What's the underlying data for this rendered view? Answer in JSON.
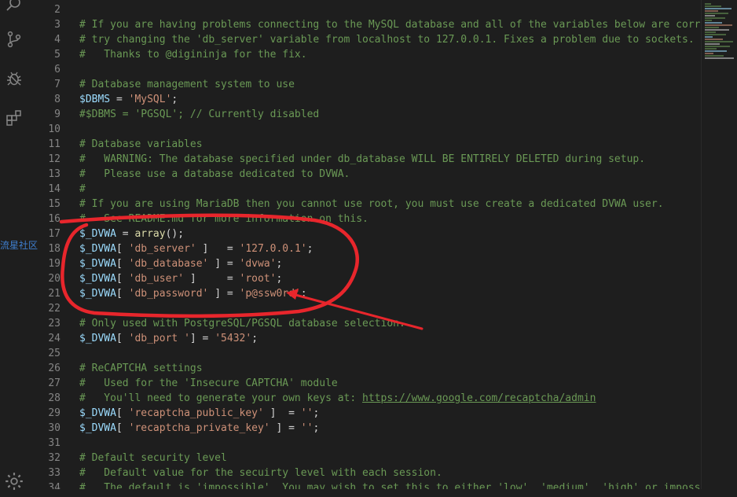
{
  "watermark": "流星社区",
  "activity_bar": {
    "icons": [
      "search-icon",
      "source-control-icon",
      "debug-icon",
      "extensions-icon",
      "settings-gear-icon"
    ]
  },
  "editor": {
    "lines": [
      {
        "n": "2",
        "tokens": []
      },
      {
        "n": "3",
        "tokens": [
          {
            "t": "cm",
            "v": "# If you are having problems connecting to the MySQL database and all of the variables below are correct"
          }
        ]
      },
      {
        "n": "4",
        "tokens": [
          {
            "t": "cm",
            "v": "# try changing the 'db_server' variable from localhost to 127.0.0.1. Fixes a problem due to sockets."
          }
        ]
      },
      {
        "n": "5",
        "tokens": [
          {
            "t": "cm",
            "v": "#   Thanks to @digininja for the fix."
          }
        ]
      },
      {
        "n": "6",
        "tokens": []
      },
      {
        "n": "7",
        "tokens": [
          {
            "t": "cm",
            "v": "# Database management system to use"
          }
        ]
      },
      {
        "n": "8",
        "tokens": [
          {
            "t": "var",
            "v": "$DBMS"
          },
          {
            "t": "op",
            "v": " = "
          },
          {
            "t": "str",
            "v": "'MySQL'"
          },
          {
            "t": "op",
            "v": ";"
          }
        ]
      },
      {
        "n": "9",
        "tokens": [
          {
            "t": "cm",
            "v": "#$DBMS = 'PGSQL'; // Currently disabled"
          }
        ]
      },
      {
        "n": "10",
        "tokens": []
      },
      {
        "n": "11",
        "tokens": [
          {
            "t": "cm",
            "v": "# Database variables"
          }
        ]
      },
      {
        "n": "12",
        "tokens": [
          {
            "t": "cm",
            "v": "#   WARNING: The database specified under db_database WILL BE ENTIRELY DELETED during setup."
          }
        ]
      },
      {
        "n": "13",
        "tokens": [
          {
            "t": "cm",
            "v": "#   Please use a database dedicated to DVWA."
          }
        ]
      },
      {
        "n": "14",
        "tokens": [
          {
            "t": "cm",
            "v": "#"
          }
        ]
      },
      {
        "n": "15",
        "tokens": [
          {
            "t": "cm",
            "v": "# If you are using MariaDB then you cannot use root, you must use create a dedicated DVWA user."
          }
        ]
      },
      {
        "n": "16",
        "tokens": [
          {
            "t": "cm",
            "v": "#   See README.md for more information on this."
          }
        ]
      },
      {
        "n": "17",
        "tokens": [
          {
            "t": "var",
            "v": "$_DVWA"
          },
          {
            "t": "op",
            "v": " = "
          },
          {
            "t": "fn",
            "v": "array"
          },
          {
            "t": "op",
            "v": "();"
          }
        ]
      },
      {
        "n": "18",
        "tokens": [
          {
            "t": "var",
            "v": "$_DVWA"
          },
          {
            "t": "op",
            "v": "[ "
          },
          {
            "t": "str",
            "v": "'db_server'"
          },
          {
            "t": "op",
            "v": " ]   = "
          },
          {
            "t": "str",
            "v": "'127.0.0.1'"
          },
          {
            "t": "op",
            "v": ";"
          }
        ]
      },
      {
        "n": "19",
        "tokens": [
          {
            "t": "var",
            "v": "$_DVWA"
          },
          {
            "t": "op",
            "v": "[ "
          },
          {
            "t": "str",
            "v": "'db_database'"
          },
          {
            "t": "op",
            "v": " ] = "
          },
          {
            "t": "str",
            "v": "'dvwa'"
          },
          {
            "t": "op",
            "v": ";"
          }
        ]
      },
      {
        "n": "20",
        "tokens": [
          {
            "t": "var",
            "v": "$_DVWA"
          },
          {
            "t": "op",
            "v": "[ "
          },
          {
            "t": "str",
            "v": "'db_user'"
          },
          {
            "t": "op",
            "v": " ]     = "
          },
          {
            "t": "str",
            "v": "'root'"
          },
          {
            "t": "op",
            "v": ";"
          }
        ]
      },
      {
        "n": "21",
        "tokens": [
          {
            "t": "var",
            "v": "$_DVWA"
          },
          {
            "t": "op",
            "v": "[ "
          },
          {
            "t": "str",
            "v": "'db_password'"
          },
          {
            "t": "op",
            "v": " ] = "
          },
          {
            "t": "str",
            "v": "'p@ssw0rd'"
          },
          {
            "t": "op",
            "v": ";"
          }
        ]
      },
      {
        "n": "22",
        "tokens": []
      },
      {
        "n": "23",
        "tokens": [
          {
            "t": "cm",
            "v": "# Only used with PostgreSQL/PGSQL database selection."
          }
        ]
      },
      {
        "n": "24",
        "tokens": [
          {
            "t": "var",
            "v": "$_DVWA"
          },
          {
            "t": "op",
            "v": "[ "
          },
          {
            "t": "str",
            "v": "'db_port '"
          },
          {
            "t": "op",
            "v": "] = "
          },
          {
            "t": "str",
            "v": "'5432'"
          },
          {
            "t": "op",
            "v": ";"
          }
        ]
      },
      {
        "n": "25",
        "tokens": []
      },
      {
        "n": "26",
        "tokens": [
          {
            "t": "cm",
            "v": "# ReCAPTCHA settings"
          }
        ]
      },
      {
        "n": "27",
        "tokens": [
          {
            "t": "cm",
            "v": "#   Used for the 'Insecure CAPTCHA' module"
          }
        ]
      },
      {
        "n": "28",
        "tokens": [
          {
            "t": "cm",
            "v": "#   You'll need to generate your own keys at: "
          },
          {
            "t": "link",
            "v": "https://www.google.com/recaptcha/admin"
          }
        ]
      },
      {
        "n": "29",
        "tokens": [
          {
            "t": "var",
            "v": "$_DVWA"
          },
          {
            "t": "op",
            "v": "[ "
          },
          {
            "t": "str",
            "v": "'recaptcha_public_key'"
          },
          {
            "t": "op",
            "v": " ]  = "
          },
          {
            "t": "str",
            "v": "''"
          },
          {
            "t": "op",
            "v": ";"
          }
        ]
      },
      {
        "n": "30",
        "tokens": [
          {
            "t": "var",
            "v": "$_DVWA"
          },
          {
            "t": "op",
            "v": "[ "
          },
          {
            "t": "str",
            "v": "'recaptcha_private_key'"
          },
          {
            "t": "op",
            "v": " ] = "
          },
          {
            "t": "str",
            "v": "''"
          },
          {
            "t": "op",
            "v": ";"
          }
        ]
      },
      {
        "n": "31",
        "tokens": []
      },
      {
        "n": "32",
        "tokens": [
          {
            "t": "cm",
            "v": "# Default security level"
          }
        ]
      },
      {
        "n": "33",
        "tokens": [
          {
            "t": "cm",
            "v": "#   Default value for the secuirty level with each session."
          }
        ]
      },
      {
        "n": "34",
        "tokens": [
          {
            "t": "cm",
            "v": "#   The default is 'impossible'. You may wish to set this to either 'low', 'medium', 'high' or impossible"
          }
        ]
      }
    ]
  },
  "colors": {
    "background": "#1e1e1e",
    "comment": "#6a9955",
    "variable": "#9cdcfe",
    "string": "#ce9178",
    "function": "#dcdcaa",
    "annotation": "#e8262c"
  }
}
